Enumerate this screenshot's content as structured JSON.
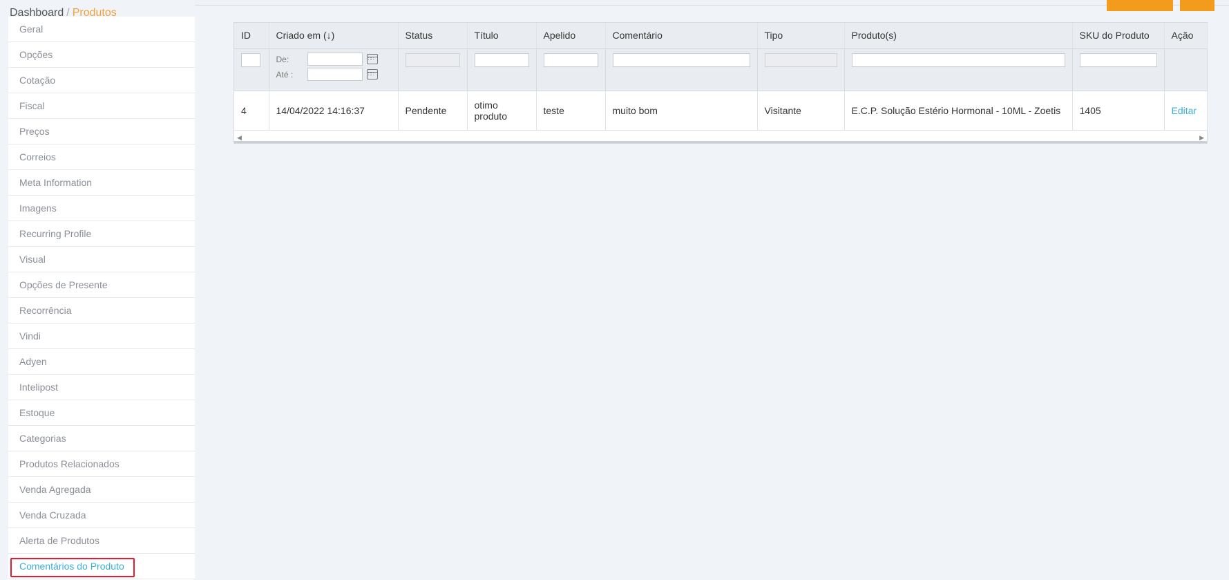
{
  "breadcrumb": {
    "root": "Dashboard",
    "separator": "/",
    "current": "Produtos"
  },
  "sidebar": {
    "items": [
      {
        "label": "Geral"
      },
      {
        "label": "Opções"
      },
      {
        "label": "Cotação"
      },
      {
        "label": "Fiscal"
      },
      {
        "label": "Preços"
      },
      {
        "label": "Correios"
      },
      {
        "label": "Meta Information"
      },
      {
        "label": "Imagens"
      },
      {
        "label": "Recurring Profile"
      },
      {
        "label": "Visual"
      },
      {
        "label": "Opções de Presente"
      },
      {
        "label": "Recorrência"
      },
      {
        "label": "Vindi"
      },
      {
        "label": "Adyen"
      },
      {
        "label": "Intelipost"
      },
      {
        "label": "Estoque"
      },
      {
        "label": "Categorias"
      },
      {
        "label": "Produtos Relacionados"
      },
      {
        "label": "Venda Agregada"
      },
      {
        "label": "Venda Cruzada"
      },
      {
        "label": "Alerta de Produtos"
      },
      {
        "label": "Comentários do Produto"
      }
    ],
    "active_index": 21
  },
  "grid": {
    "columns": [
      "ID",
      "Criado em (↓)",
      "Status",
      "Título",
      "Apelido",
      "Comentário",
      "Tipo",
      "Produto(s)",
      "SKU do Produto",
      "Ação"
    ],
    "date_filter": {
      "from_label": "De:",
      "to_label": "Até :"
    },
    "rows": [
      {
        "id": "4",
        "created": "14/04/2022 14:16:37",
        "status": "Pendente",
        "title": "otimo produto",
        "nickname": "teste",
        "comment": "muito bom",
        "type": "Visitante",
        "product": "E.C.P. Solução Estério Hormonal - 10ML - Zoetis",
        "sku": "1405",
        "action": "Editar"
      }
    ]
  },
  "colors": {
    "accent": "#f29b1d",
    "link": "#3ab0d6",
    "highlight": "#e8192c"
  }
}
